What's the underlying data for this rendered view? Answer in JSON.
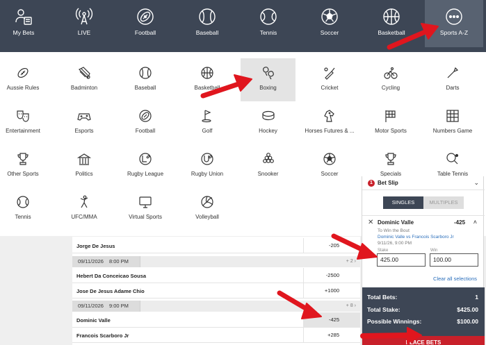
{
  "nav": {
    "items": [
      {
        "label": "My Bets",
        "icon": "user-bets-icon"
      },
      {
        "label": "LIVE",
        "icon": "live-broadcast-icon"
      },
      {
        "label": "Football",
        "icon": "american-football-icon"
      },
      {
        "label": "Baseball",
        "icon": "baseball-icon"
      },
      {
        "label": "Tennis",
        "icon": "tennis-ball-icon"
      },
      {
        "label": "Soccer",
        "icon": "soccer-ball-icon"
      },
      {
        "label": "Basketball",
        "icon": "basketball-icon"
      },
      {
        "label": "Sports A-Z",
        "icon": "more-dots-icon"
      }
    ],
    "active": "Sports A-Z"
  },
  "sports": {
    "row1": [
      "Aussie Rules",
      "Badminton",
      "Baseball",
      "Basketball",
      "Boxing",
      "Cricket",
      "Cycling",
      "Darts"
    ],
    "row2": [
      "Entertainment",
      "Esports",
      "Football",
      "Golf",
      "Hockey",
      "Horses Futures & ...",
      "Motor Sports",
      "Numbers Game"
    ],
    "row3": [
      "Other Sports",
      "Politics",
      "Rugby League",
      "Rugby Union",
      "Snooker",
      "Soccer",
      "Specials",
      "Table Tennis"
    ],
    "row4": [
      "Tennis",
      "UFC/MMA",
      "Virtual Sports",
      "Volleyball"
    ],
    "active": "Boxing"
  },
  "events": {
    "row_top": {
      "name": "Jorge De Jesus",
      "odds": "-205"
    },
    "group1": {
      "date": "09/11/2026",
      "time": "8:00 PM",
      "more": "+ 2"
    },
    "row1a": {
      "name": "Hebert Da Conceicao Sousa",
      "odds": "-2500"
    },
    "row1b": {
      "name": "Jose De Jesus Adame Chio",
      "odds": "+1000"
    },
    "group2": {
      "date": "09/11/2026",
      "time": "9:00 PM",
      "more": "+ 8"
    },
    "row2a": {
      "name": "Dominic Valle",
      "odds": "-425"
    },
    "row2b": {
      "name": "Francois Scarboro Jr",
      "odds": "+285"
    }
  },
  "betslip": {
    "badge": "1",
    "title": "Bet Slip",
    "tab_singles": "SINGLES",
    "tab_multiples": "MULTIPLES",
    "selection": {
      "name": "Dominic Valle",
      "odds": "-425",
      "market": "To Win the Bout",
      "event": "Dominic Valle vs Francois Scarboro Jr",
      "time": "9/11/26, 9:00 PM",
      "stake_label": "Stake",
      "win_label": "Win",
      "stake_value": "425.00",
      "win_value": "100.00"
    },
    "clear_all": "Clear all selections",
    "total_bets_label": "Total Bets:",
    "total_bets_value": "1",
    "total_stake_label": "Total Stake:",
    "total_stake_value": "$425.00",
    "possible_win_label": "Possible Winnings:",
    "possible_win_value": "$100.00",
    "place_bets": "PLACE BETS"
  },
  "colors": {
    "nav_bg": "#3d4655",
    "accent_red": "#c8202a",
    "link_blue": "#2a6ebb"
  }
}
